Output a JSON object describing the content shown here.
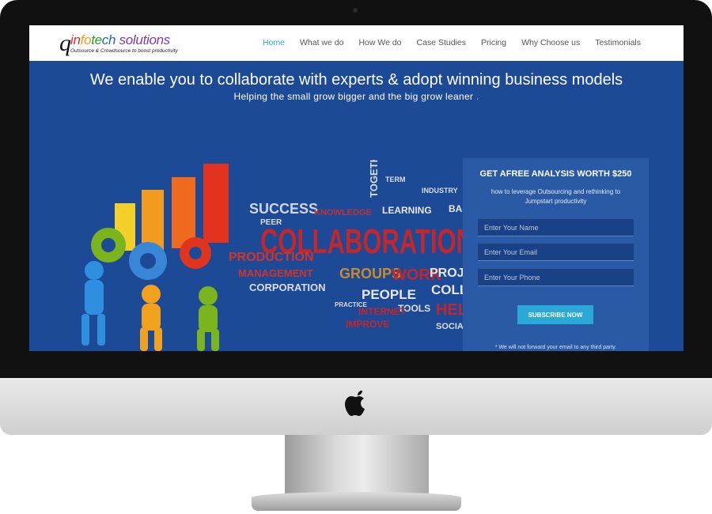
{
  "nav": {
    "logo_mark": "q",
    "logo_parts": [
      "in",
      "fo",
      "te",
      "ch",
      " solutions"
    ],
    "logo_tagline": "Outsource & Crowdsource to boost productivity",
    "items": [
      {
        "label": "Home",
        "active": true
      },
      {
        "label": "What we do"
      },
      {
        "label": "How We do"
      },
      {
        "label": "Case Studies"
      },
      {
        "label": "Pricing"
      },
      {
        "label": "Why Choose us"
      },
      {
        "label": "Testimonials"
      }
    ]
  },
  "hero": {
    "title": "We enable you to collaborate with experts & adopt winning business models",
    "subtitle": "Helping the small grow bigger and the big grow leaner ."
  },
  "art_words": {
    "main": "COLLABORATION",
    "words": [
      "SUCCESS",
      "KNOWLEDGE",
      "LEARNING",
      "BASED",
      "PRODUCTION",
      "MANAGEMENT",
      "CORPORATION",
      "GROUPS",
      "WORK",
      "PROJECT",
      "PEOPLE",
      "COLLABO",
      "TOOLS",
      "HELP",
      "SOCIAL",
      "INTERNET",
      "TOGETHER",
      "INDUSTRY",
      "TERM",
      "PEER",
      "PRACTICE",
      "IMPROVE"
    ]
  },
  "form": {
    "title": "GET AFREE ANALYSIS WORTH $250",
    "description": "how to leverage Outsourcing and rethinking to Jumpstart productivity",
    "name_placeholder": "Enter Your Name",
    "email_placeholder": "Enter Your Email",
    "phone_placeholder": "Enter Your Phone",
    "button": "SUBSCRIBE NOW",
    "disclaimer": "* We will not forward your email to any third party."
  },
  "colors": {
    "hero_bg": "#1d4a96",
    "accent": "#2aa9d8"
  }
}
